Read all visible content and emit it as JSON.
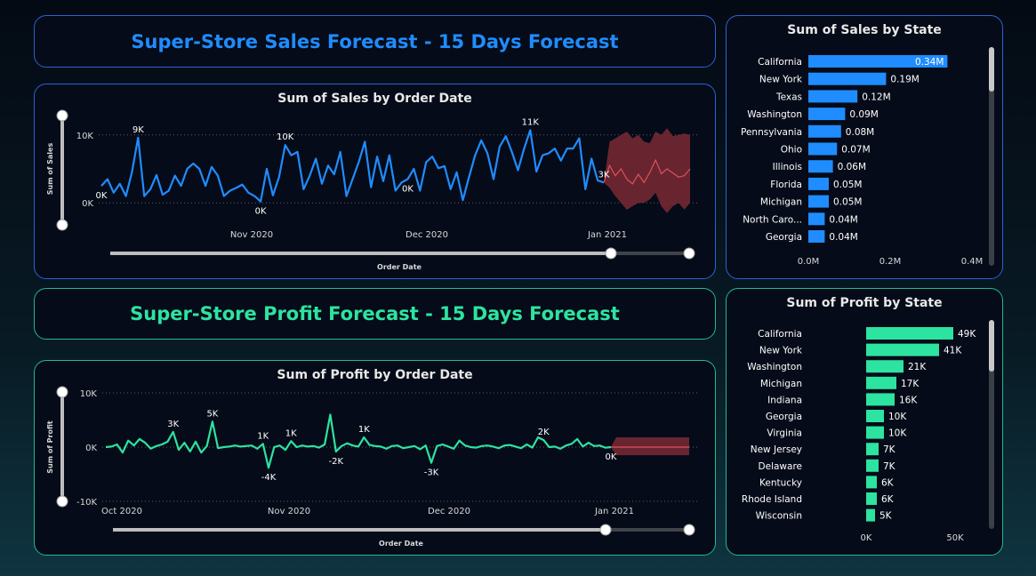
{
  "colors": {
    "sales": "#1f8cff",
    "profit": "#2de3a0",
    "forecast_band": "#7a2a35",
    "forecast_line": "#e0505a",
    "label": "#ffffff",
    "muted": "#d9d9d9"
  },
  "sales_banner": {
    "title": "Super-Store Sales Forecast - 15 Days Forecast"
  },
  "profit_banner": {
    "title": "Super-Store Profit Forecast - 15 Days Forecast"
  },
  "chart_data": [
    {
      "id": "sales_by_date",
      "type": "line",
      "title": "Sum of Sales by Order Date",
      "xlabel": "Order Date",
      "ylabel": "Sum of Sales",
      "x_ticks": [
        "Nov 2020",
        "Dec 2020",
        "Jan 2021"
      ],
      "y_ticks": [
        "0K",
        "10K"
      ],
      "ylim": [
        -3500,
        13500
      ],
      "series": [
        {
          "values": [
            2500,
            3500,
            1500,
            2800,
            1000,
            4600,
            9600,
            1000,
            2000,
            4100,
            1200,
            1800,
            4000,
            2500,
            5000,
            5800,
            5000,
            2500,
            5300,
            4000,
            1000,
            1800,
            2200,
            2700,
            1500,
            1000,
            200,
            5000,
            1100,
            3800,
            8500,
            7000,
            7500,
            2000,
            4000,
            6500,
            2800,
            5500,
            4200,
            7500,
            1000,
            3500,
            6000,
            9000,
            2300,
            6800,
            3200,
            7000,
            1800,
            3000,
            3500,
            5000,
            1800,
            6000,
            6800,
            5100,
            5400,
            2000,
            4500,
            400,
            3800,
            7000,
            9200,
            7300,
            3500,
            8300,
            9800,
            7500,
            4800,
            8000,
            10700,
            4600,
            7000,
            7300,
            8000,
            6200,
            8000,
            8000,
            9500,
            2000,
            6500,
            3300,
            3000
          ]
        },
        {
          "name": "Forecast",
          "values": [
            5500,
            4000,
            5000,
            3500,
            2800,
            4200,
            3000,
            4500,
            6300,
            4300,
            5000,
            4400,
            3800,
            4000,
            5000
          ],
          "band_upper": [
            9000,
            9500,
            10000,
            10500,
            9500,
            10000,
            9000,
            8800,
            10500,
            10000,
            11000,
            9800,
            10000,
            10200,
            10000
          ],
          "band_lower": [
            2200,
            1000,
            0,
            -1000,
            -500,
            0,
            0,
            500,
            1500,
            -500,
            -1500,
            -500,
            0,
            -1000,
            0
          ]
        }
      ],
      "data_labels": [
        {
          "text": "9K",
          "index": 6
        },
        {
          "text": "10K",
          "index": 30
        },
        {
          "text": "11K",
          "index": 70
        },
        {
          "text": "3K",
          "index": 82
        },
        {
          "text": "0K",
          "index": 0
        },
        {
          "text": "0K",
          "index": 26
        },
        {
          "text": "0K",
          "index": 50
        }
      ]
    },
    {
      "id": "sales_by_state",
      "type": "bar",
      "title": "Sum of Sales by State",
      "categories": [
        "California",
        "New York",
        "Texas",
        "Washington",
        "Pennsylvania",
        "Ohio",
        "Illinois",
        "Florida",
        "Michigan",
        "North Caro...",
        "Georgia"
      ],
      "values": [
        0.34,
        0.19,
        0.12,
        0.09,
        0.08,
        0.07,
        0.06,
        0.05,
        0.05,
        0.04,
        0.04
      ],
      "value_labels": [
        "0.34M",
        "0.19M",
        "0.12M",
        "0.09M",
        "0.08M",
        "0.07M",
        "0.06M",
        "0.05M",
        "0.05M",
        "0.04M",
        "0.04M"
      ],
      "x_ticks": [
        "0.0M",
        "0.2M",
        "0.4M"
      ],
      "xlim": [
        0,
        0.4
      ]
    },
    {
      "id": "profit_by_date",
      "type": "line",
      "title": "Sum of Profit by Order Date",
      "xlabel": "Order Date",
      "ylabel": "Sum of Profit",
      "x_ticks": [
        "Oct 2020",
        "Nov 2020",
        "Dec 2020",
        "Jan 2021"
      ],
      "y_ticks": [
        "10K",
        "0K",
        "-10K"
      ],
      "ylim": [
        -10000,
        10000
      ],
      "series": [
        {
          "values": [
            0,
            100,
            500,
            -1000,
            1200,
            300,
            1500,
            800,
            -300,
            200,
            500,
            1000,
            2800,
            -500,
            800,
            -800,
            1000,
            -1000,
            200,
            4700,
            -200,
            0,
            100,
            300,
            100,
            200,
            300,
            -300,
            600,
            -3800,
            0,
            300,
            -500,
            1100,
            0,
            300,
            100,
            200,
            -100,
            500,
            6000,
            -800,
            200,
            700,
            300,
            100,
            1800,
            400,
            200,
            100,
            -300,
            200,
            300,
            -200,
            0,
            200,
            -400,
            300,
            -2900,
            200,
            500,
            100,
            -300,
            1200,
            300,
            0,
            -100,
            200,
            300,
            100,
            -200,
            300,
            400,
            100,
            -200,
            500,
            -100,
            1800,
            1300,
            0,
            100,
            -300,
            300,
            600,
            1500,
            100,
            800,
            200,
            300,
            -100,
            0
          ]
        },
        {
          "name": "Forecast",
          "values": [
            0,
            0,
            0,
            0,
            0,
            0,
            0,
            0,
            0,
            0,
            0,
            0,
            0,
            0,
            0
          ],
          "band_upper": [
            1800,
            1800,
            1800,
            1800,
            1800,
            1800,
            1800,
            1800,
            1800,
            1800,
            1800,
            1800,
            1800,
            1800,
            1800
          ],
          "band_lower": [
            -1500,
            -1500,
            -1500,
            -1500,
            -1500,
            -1500,
            -1500,
            -1500,
            -1500,
            -1500,
            -1500,
            -1500,
            -1500,
            -1500,
            -1500
          ]
        }
      ],
      "data_labels": [
        {
          "text": "3K",
          "index": 12
        },
        {
          "text": "5K",
          "index": 19
        },
        {
          "text": "1K",
          "index": 28
        },
        {
          "text": "-4K",
          "index": 29
        },
        {
          "text": "1K",
          "index": 33
        },
        {
          "text": "-2K",
          "index": 41
        },
        {
          "text": "1K",
          "index": 46
        },
        {
          "text": "-3K",
          "index": 58
        },
        {
          "text": "2K",
          "index": 78
        },
        {
          "text": "0K",
          "index": 90
        }
      ]
    },
    {
      "id": "profit_by_state",
      "type": "bar",
      "title": "Sum of Profit by State",
      "categories": [
        "California",
        "New York",
        "Washington",
        "Michigan",
        "Indiana",
        "Georgia",
        "Virginia",
        "New Jersey",
        "Delaware",
        "Kentucky",
        "Rhode Island",
        "Wisconsin"
      ],
      "values": [
        49,
        41,
        21,
        17,
        16,
        10,
        10,
        7,
        7,
        6,
        6,
        5
      ],
      "value_labels": [
        "49K",
        "41K",
        "21K",
        "17K",
        "16K",
        "10K",
        "10K",
        "7K",
        "7K",
        "6K",
        "6K",
        "5K"
      ],
      "x_ticks": [
        "0K",
        "50K"
      ],
      "xlim": [
        0,
        60
      ]
    }
  ]
}
